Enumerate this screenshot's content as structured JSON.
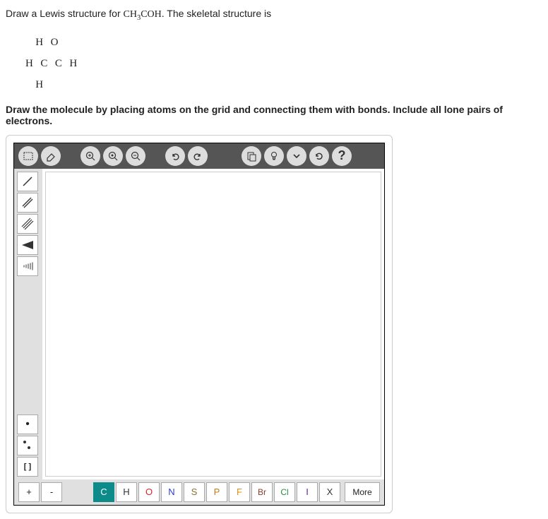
{
  "question": {
    "prefix": "Draw a Lewis structure for ",
    "formula_main": "CH",
    "formula_sub": "3",
    "formula_rest": "COH",
    "suffix": ". The skeletal structure is"
  },
  "skeletal": {
    "row1": "   H  O",
    "row2": "H  C  C  H",
    "row3": "   H"
  },
  "instruction": "Draw the molecule by placing atoms on the grid and connecting them with bonds. Include all lone pairs of electrons.",
  "toolbar": {
    "marquee": "⬚",
    "eraser": "⌫",
    "zoom_in": "+",
    "zoom_fit": "⊙",
    "zoom_out": "−",
    "undo": "↶",
    "redo": "↷",
    "paste": "📋",
    "hint": "💡",
    "expand": "⌄",
    "reset": "↻",
    "help": "?"
  },
  "side": {
    "single": "/",
    "double": "//",
    "triple": "///",
    "lone1": "•",
    "bracket": "[ ]"
  },
  "bottom": {
    "plus": "+",
    "minus": "-",
    "c": "C",
    "h": "H",
    "o": "O",
    "n": "N",
    "s": "S",
    "p": "P",
    "f": "F",
    "br": "Br",
    "cl": "Cl",
    "i": "I",
    "x": "X",
    "more": "More"
  }
}
